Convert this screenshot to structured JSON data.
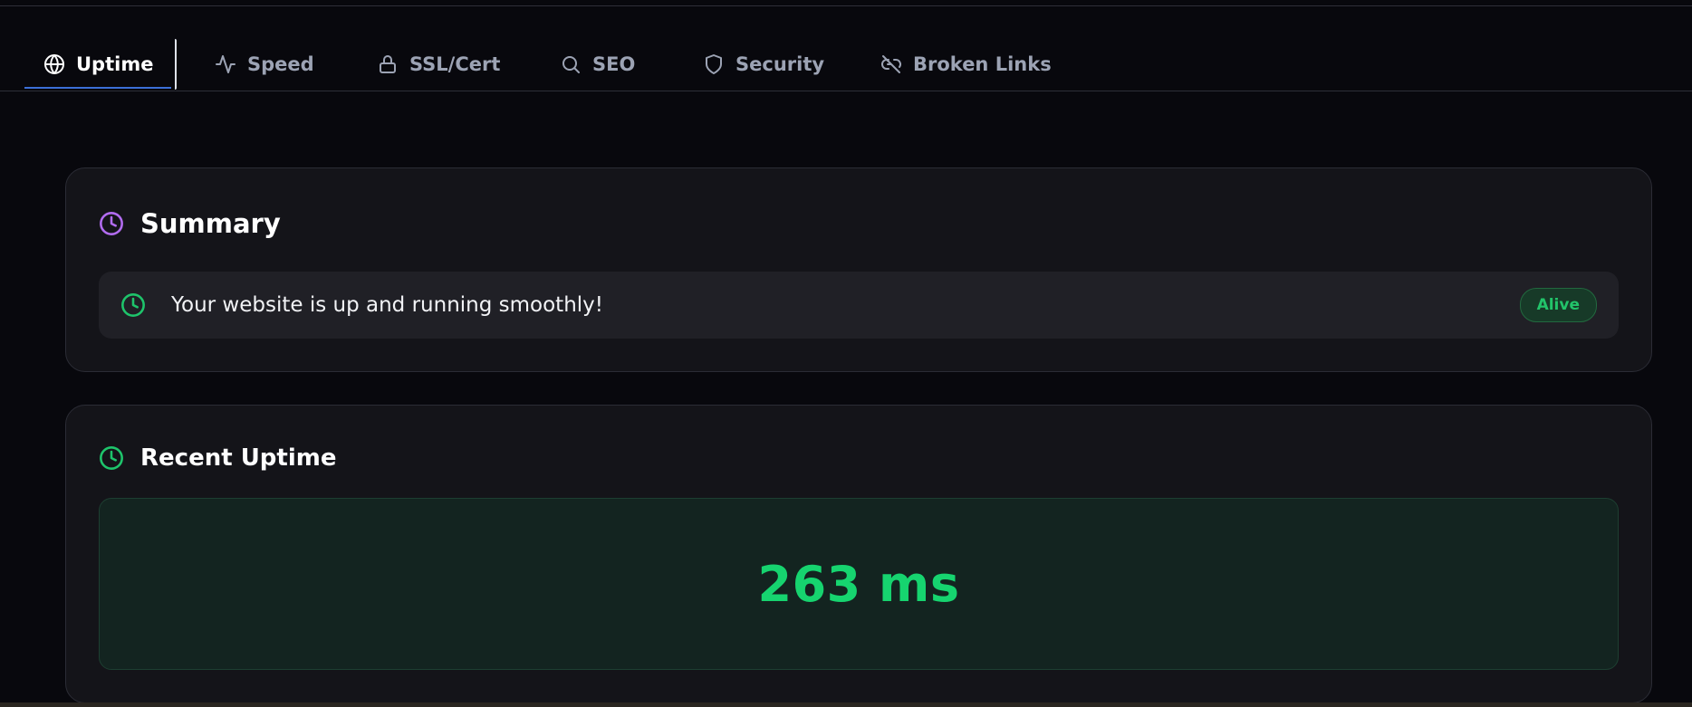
{
  "tabs": [
    {
      "label": "Uptime",
      "icon": "globe-icon",
      "active": true
    },
    {
      "label": "Speed",
      "icon": "activity-icon",
      "active": false
    },
    {
      "label": "SSL/Cert",
      "icon": "lock-icon",
      "active": false
    },
    {
      "label": "SEO",
      "icon": "search-icon",
      "active": false
    },
    {
      "label": "Security",
      "icon": "shield-icon",
      "active": false
    },
    {
      "label": "Broken Links",
      "icon": "unlink-icon",
      "active": false
    }
  ],
  "summary": {
    "title": "Summary",
    "icon": "clock-icon",
    "message": "Your website is up and running smoothly!",
    "status_badge": "Alive"
  },
  "recent_uptime": {
    "title": "Recent Uptime",
    "icon": "clock-icon",
    "response_time": "263 ms"
  },
  "colors": {
    "background": "#08080d",
    "card": "#141419",
    "accent_green": "#16d46f",
    "accent_purple": "#b26cf0",
    "active_tab_underline": "#3b6fd8"
  }
}
